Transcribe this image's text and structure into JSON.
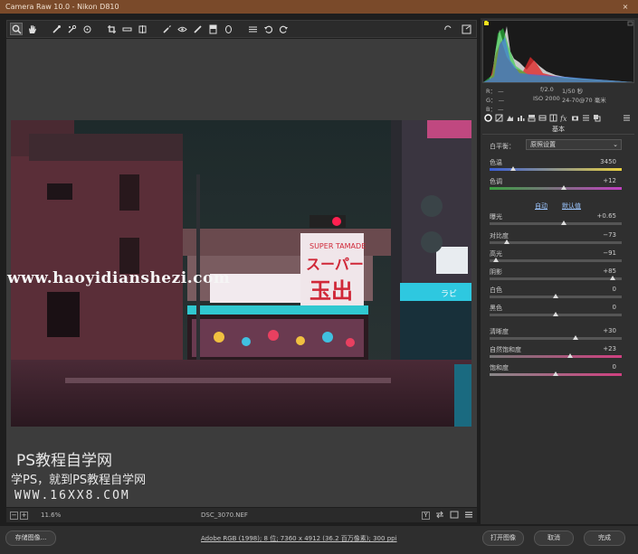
{
  "window": {
    "title": "Camera Raw 10.0 -  Nikon D810",
    "close_glyph": "×"
  },
  "toolbar": {
    "tools": [
      "zoom-tool",
      "hand-tool",
      "white-balance-tool",
      "color-sampler-tool",
      "targeted-adjustment-tool",
      "crop-tool",
      "straighten-tool",
      "transform-tool",
      "spot-removal-tool",
      "red-eye-tool",
      "adjustment-brush",
      "graduated-filter",
      "radial-filter",
      "preferences",
      "rotate-left",
      "rotate-right"
    ]
  },
  "status": {
    "zoom": "11.6%",
    "filename": "DSC_3070.NEF",
    "minus": "−",
    "plus": "+",
    "compare": "Y"
  },
  "camera_info": {
    "r_label": "R：",
    "g_label": "G：",
    "b_label": "B：",
    "r_value": "—",
    "g_value": "—",
    "b_value": "—",
    "aperture": "f/2.0",
    "shutter": "1/50 秒",
    "iso": "ISO 2000",
    "lens": "24-70@70 毫米"
  },
  "panel": {
    "title": "基本",
    "white_balance_label": "白平衡：",
    "white_balance_value": "原照设置",
    "auto_link": "自动",
    "default_link": "默认值",
    "sliders": [
      {
        "label": "色温",
        "value": "3450",
        "pos": 0.18
      },
      {
        "label": "色调",
        "value": "+12",
        "pos": 0.56
      },
      {
        "label": "曝光",
        "value": "+0.65",
        "pos": 0.56
      },
      {
        "label": "对比度",
        "value": "−73",
        "pos": 0.13
      },
      {
        "label": "高光",
        "value": "−91",
        "pos": 0.05
      },
      {
        "label": "阴影",
        "value": "+85",
        "pos": 0.93
      },
      {
        "label": "白色",
        "value": "0",
        "pos": 0.5
      },
      {
        "label": "黑色",
        "value": "0",
        "pos": 0.5
      },
      {
        "label": "清晰度",
        "value": "+30",
        "pos": 0.65
      },
      {
        "label": "自然饱和度",
        "value": "+23",
        "pos": 0.61
      },
      {
        "label": "饱和度",
        "value": "0",
        "pos": 0.5
      }
    ]
  },
  "footer": {
    "save_label": "存储图像...",
    "workflow_info": "Adobe RGB (1998); 8 位; 7360 x 4912 (36.2 百万像素); 300 ppi",
    "open_label": "打开图像",
    "cancel_label": "取消",
    "done_label": "完成"
  },
  "watermark": {
    "url": "www.haoyidianshezi.com",
    "site": "PS教程自学网",
    "slogan": "学PS，就到PS教程自学网",
    "domain": "WWW.16XX8.COM"
  },
  "photo": {
    "sign_top": "SUPER TAMADE",
    "sign_katakana": "スーパー",
    "sign_kanji": "玉出",
    "sign_side": "ラビ"
  },
  "colors": {
    "accent": "#9cc6ff",
    "titlebar": "#7a4a2a",
    "panel": "#2f2f2f"
  }
}
